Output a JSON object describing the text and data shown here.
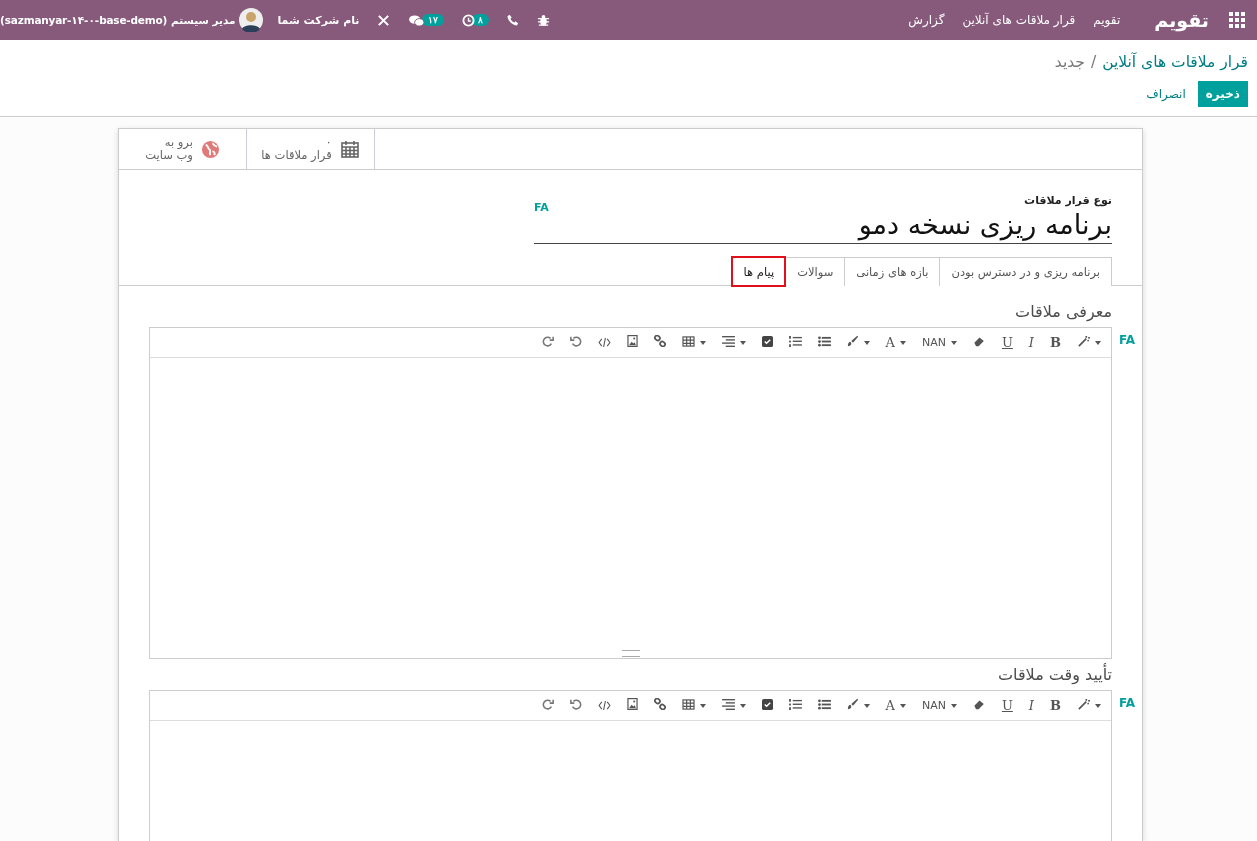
{
  "navbar": {
    "app_name": "تقویم",
    "menu": [
      "تقویم",
      "قرار ملاقات های آنلاین",
      "گزارش"
    ],
    "systray": [
      {
        "kind": "bug"
      },
      {
        "kind": "phone"
      },
      {
        "kind": "activity",
        "badge": "۸"
      },
      {
        "kind": "chat",
        "badge": "۱۷"
      },
      {
        "kind": "tools"
      }
    ],
    "company": "نام شرکت شما",
    "user": "مدیر سیستم (sazmanyar-۱۴-۰-base-demo)"
  },
  "breadcrumb": {
    "separator": "/",
    "items": [
      {
        "label": "قرار ملاقات های آنلاین",
        "kind": "link"
      },
      {
        "label": "جدید",
        "kind": "current"
      }
    ]
  },
  "buttons": [
    {
      "label": "ذخیره",
      "kind": "primary"
    },
    {
      "label": "انصراف",
      "kind": "secondary"
    }
  ],
  "stat_buttons": [
    {
      "kind": "calendar",
      "line_1": "۰",
      "line_2": "قرار ملاقات ها"
    },
    {
      "kind": "globe",
      "line_1": "برو به",
      "line_2": "وب سایت"
    }
  ],
  "title": {
    "label": "نوع قرار ملاقات",
    "value": "برنامه ریزی نسخه دمو",
    "lang": "FA"
  },
  "tabs": [
    {
      "label": "برنامه ریزی و در دسترس بودن",
      "selected": false
    },
    {
      "label": "بازه های زمانی",
      "selected": false
    },
    {
      "label": "سوالات",
      "selected": false
    },
    {
      "label": "پیام ها",
      "selected": true
    }
  ],
  "editors": [
    {
      "heading": "معرفی ملاقات",
      "lang": "FA",
      "resizable": true,
      "toolbar": [
        {
          "kind": "wand",
          "dropdown": true
        },
        {
          "kind": "text",
          "label": "B",
          "dropdown": false
        },
        {
          "kind": "text",
          "label": "I",
          "dropdown": false
        },
        {
          "kind": "text",
          "label": "U",
          "dropdown": false
        },
        {
          "kind": "eraser",
          "dropdown": false
        },
        {
          "kind": "text",
          "label": "NAN",
          "dropdown": true
        },
        {
          "kind": "text",
          "label": "A",
          "dropdown": true
        },
        {
          "kind": "brush",
          "dropdown": true
        },
        {
          "kind": "ul",
          "dropdown": false
        },
        {
          "kind": "ol",
          "dropdown": false
        },
        {
          "kind": "check",
          "dropdown": false
        },
        {
          "kind": "align",
          "dropdown": true
        },
        {
          "kind": "table",
          "dropdown": true
        },
        {
          "kind": "link",
          "dropdown": false
        },
        {
          "kind": "image",
          "dropdown": false
        },
        {
          "kind": "code",
          "dropdown": false
        },
        {
          "kind": "undo",
          "dropdown": false
        },
        {
          "kind": "redo",
          "dropdown": false
        }
      ]
    },
    {
      "heading": "تأیید وقت ملاقات",
      "lang": "FA",
      "resizable": false,
      "toolbar": [
        {
          "kind": "wand",
          "dropdown": true
        },
        {
          "kind": "text",
          "label": "B",
          "dropdown": false
        },
        {
          "kind": "text",
          "label": "I",
          "dropdown": false
        },
        {
          "kind": "text",
          "label": "U",
          "dropdown": false
        },
        {
          "kind": "eraser",
          "dropdown": false
        },
        {
          "kind": "text",
          "label": "NAN",
          "dropdown": true
        },
        {
          "kind": "text",
          "label": "A",
          "dropdown": true
        },
        {
          "kind": "brush",
          "dropdown": true
        },
        {
          "kind": "ul",
          "dropdown": false
        },
        {
          "kind": "ol",
          "dropdown": false
        },
        {
          "kind": "check",
          "dropdown": false
        },
        {
          "kind": "align",
          "dropdown": true
        },
        {
          "kind": "table",
          "dropdown": true
        },
        {
          "kind": "link",
          "dropdown": false
        },
        {
          "kind": "image",
          "dropdown": false
        },
        {
          "kind": "code",
          "dropdown": false
        },
        {
          "kind": "undo",
          "dropdown": false
        },
        {
          "kind": "redo",
          "dropdown": false
        }
      ]
    }
  ]
}
